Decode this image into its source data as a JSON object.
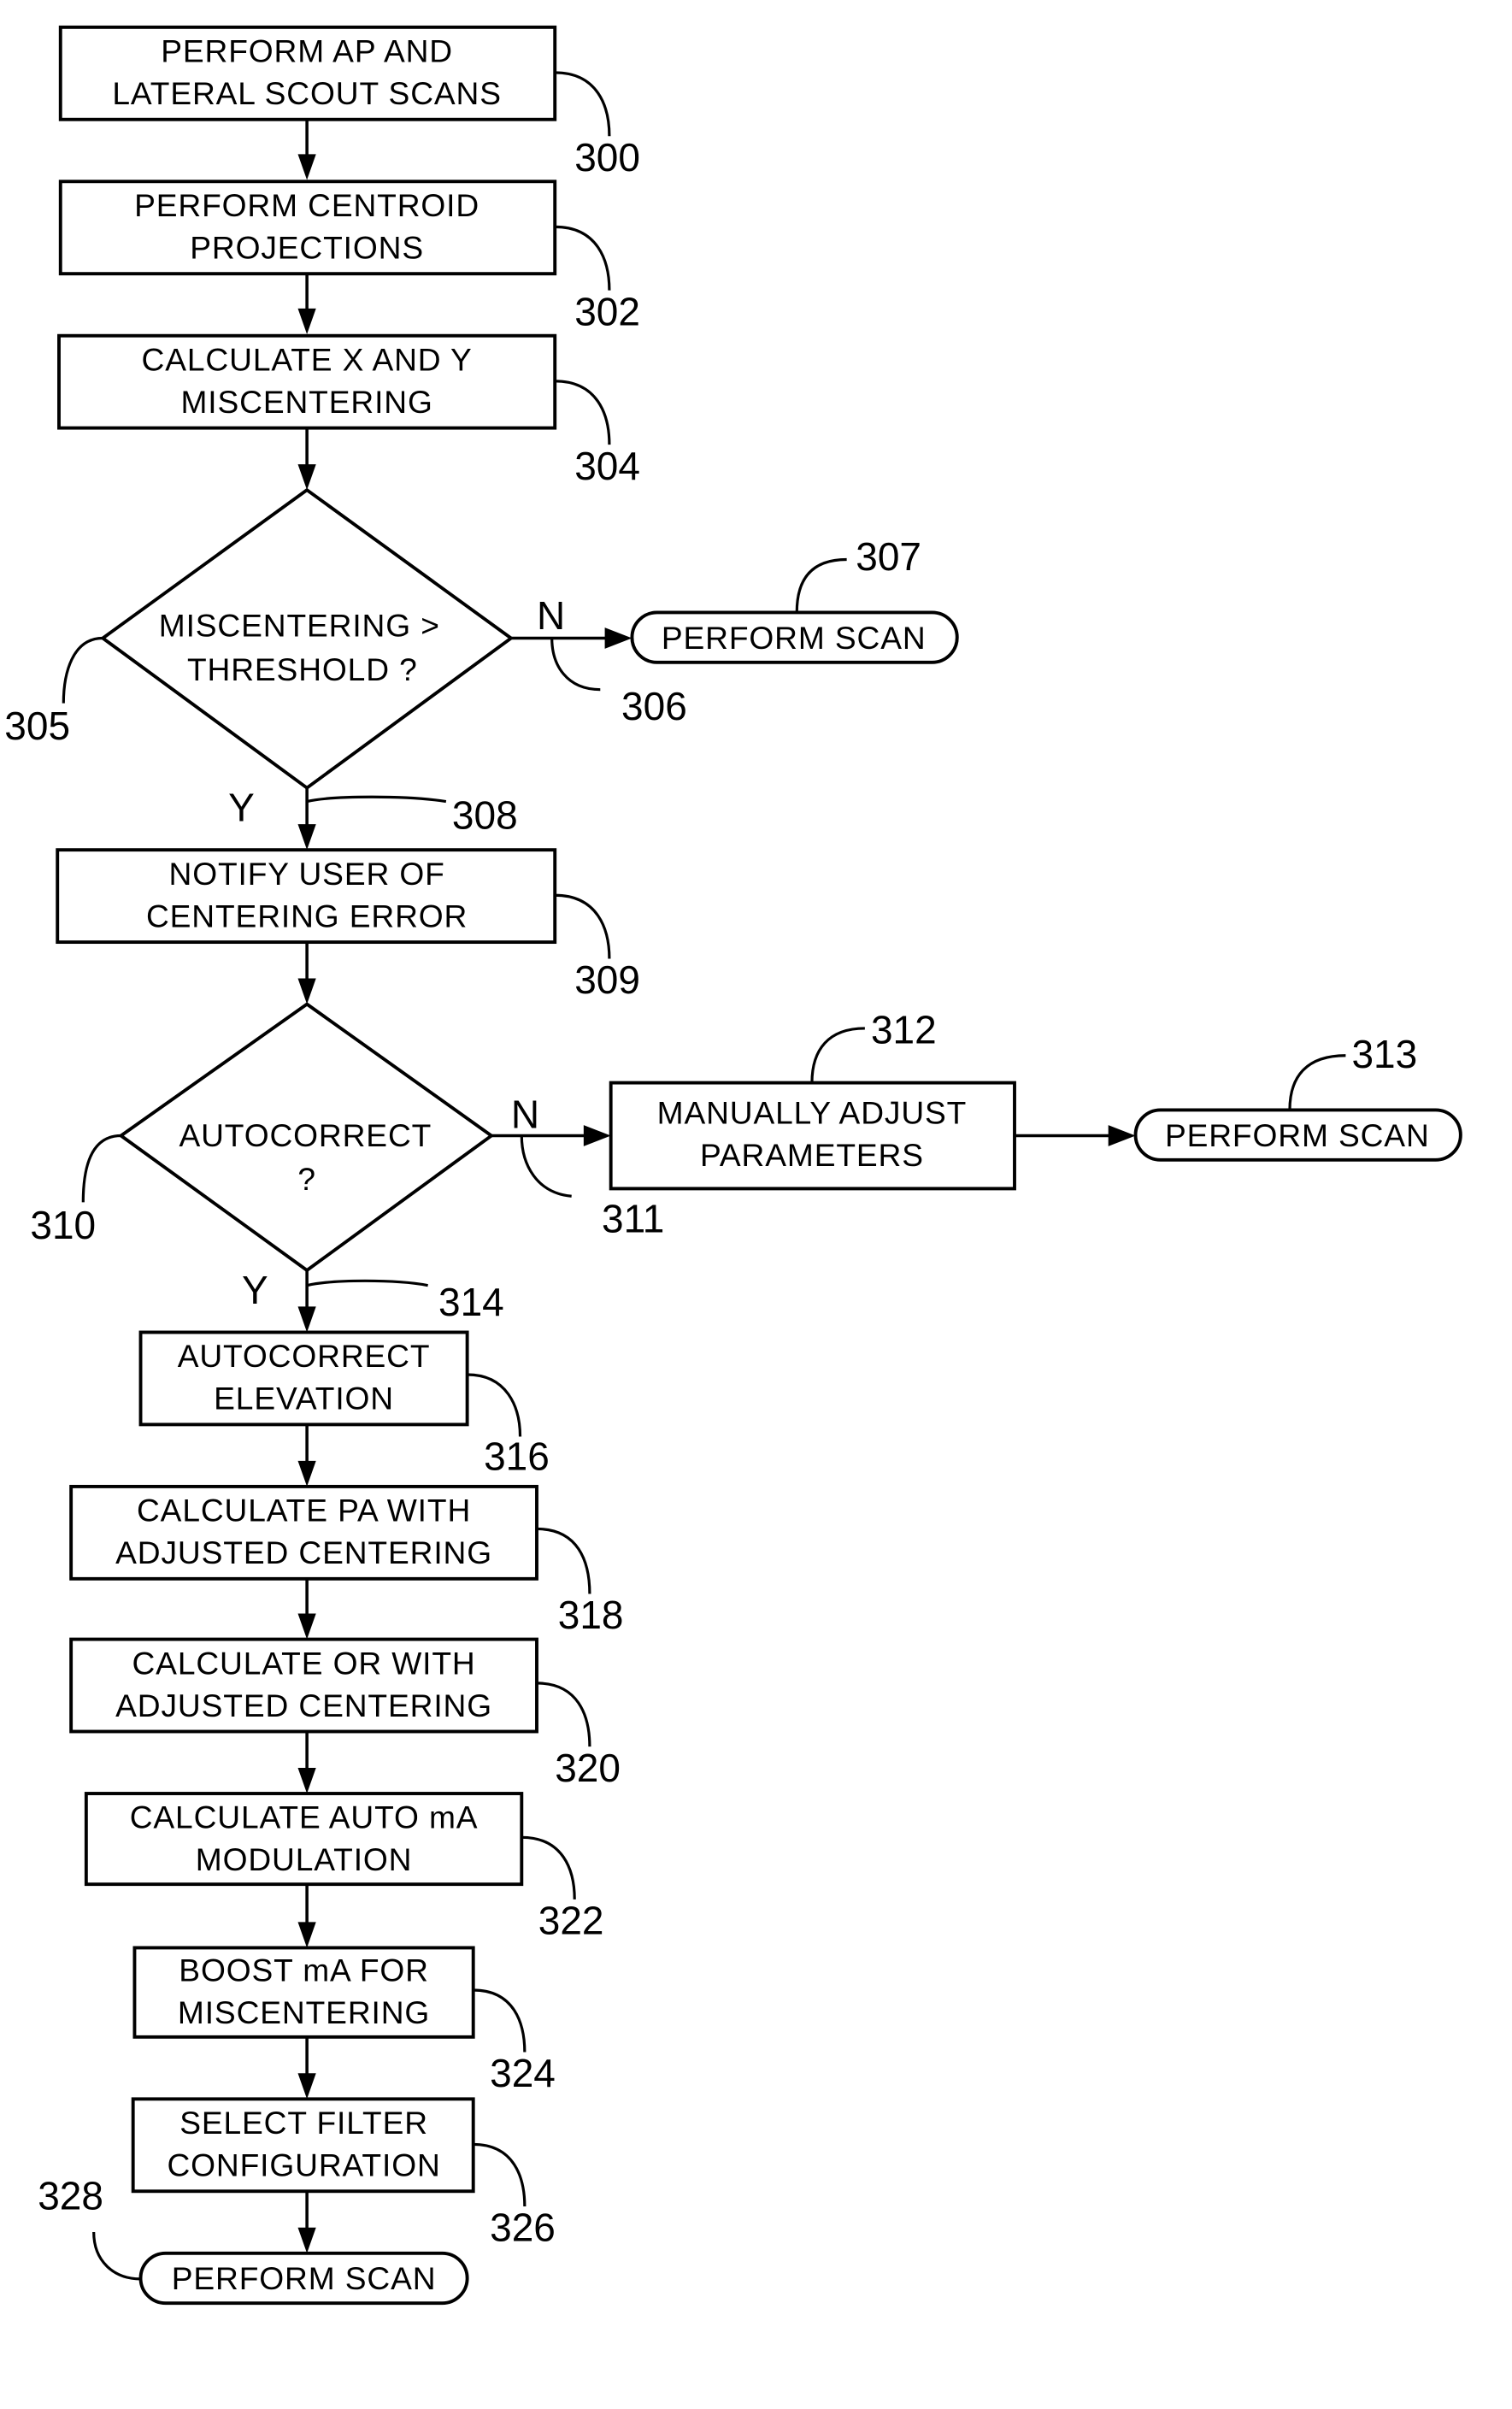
{
  "figure": {
    "nodes": [
      {
        "id": "300",
        "type": "process",
        "lines": [
          "PERFORM AP AND",
          "LATERAL SCOUT SCANS"
        ]
      },
      {
        "id": "302",
        "type": "process",
        "lines": [
          "PERFORM CENTROID",
          "PROJECTIONS"
        ]
      },
      {
        "id": "304",
        "type": "process",
        "lines": [
          "CALCULATE X AND Y",
          "MISCENTERING"
        ]
      },
      {
        "id": "305",
        "type": "decision",
        "lines": [
          "MISCENTERING >",
          "THRESHOLD ?"
        ]
      },
      {
        "id": "307",
        "type": "terminal",
        "lines": [
          "PERFORM SCAN"
        ]
      },
      {
        "id": "309",
        "type": "process",
        "lines": [
          "NOTIFY USER OF",
          "CENTERING ERROR"
        ]
      },
      {
        "id": "310",
        "type": "decision",
        "lines": [
          "AUTOCORRECT",
          "?"
        ]
      },
      {
        "id": "312",
        "type": "process",
        "lines": [
          "MANUALLY ADJUST",
          "PARAMETERS"
        ]
      },
      {
        "id": "313",
        "type": "terminal",
        "lines": [
          "PERFORM SCAN"
        ]
      },
      {
        "id": "316",
        "type": "process",
        "lines": [
          "AUTOCORRECT",
          "ELEVATION"
        ]
      },
      {
        "id": "318",
        "type": "process",
        "lines": [
          "CALCULATE PA WITH",
          "ADJUSTED CENTERING"
        ]
      },
      {
        "id": "320",
        "type": "process",
        "lines": [
          "CALCULATE OR WITH",
          "ADJUSTED CENTERING"
        ]
      },
      {
        "id": "322",
        "type": "process",
        "lines": [
          "CALCULATE AUTO mA",
          "MODULATION"
        ]
      },
      {
        "id": "324",
        "type": "process",
        "lines": [
          "BOOST mA FOR",
          "MISCENTERING"
        ]
      },
      {
        "id": "326",
        "type": "process",
        "lines": [
          "SELECT FILTER",
          "CONFIGURATION"
        ]
      },
      {
        "id": "328",
        "type": "terminal",
        "lines": [
          "PERFORM SCAN"
        ]
      }
    ],
    "branch_labels": {
      "n_305": "N",
      "y_305": "Y",
      "n_310": "N",
      "y_310": "Y"
    },
    "reference_numerals": {
      "r300": "300",
      "r302": "302",
      "r304": "304",
      "r305": "305",
      "r306": "306",
      "r307": "307",
      "r308": "308",
      "r309": "309",
      "r310": "310",
      "r311": "311",
      "r312": "312",
      "r313": "313",
      "r314": "314",
      "r316": "316",
      "r318": "318",
      "r320": "320",
      "r322": "322",
      "r324": "324",
      "r326": "326",
      "r328": "328"
    }
  }
}
